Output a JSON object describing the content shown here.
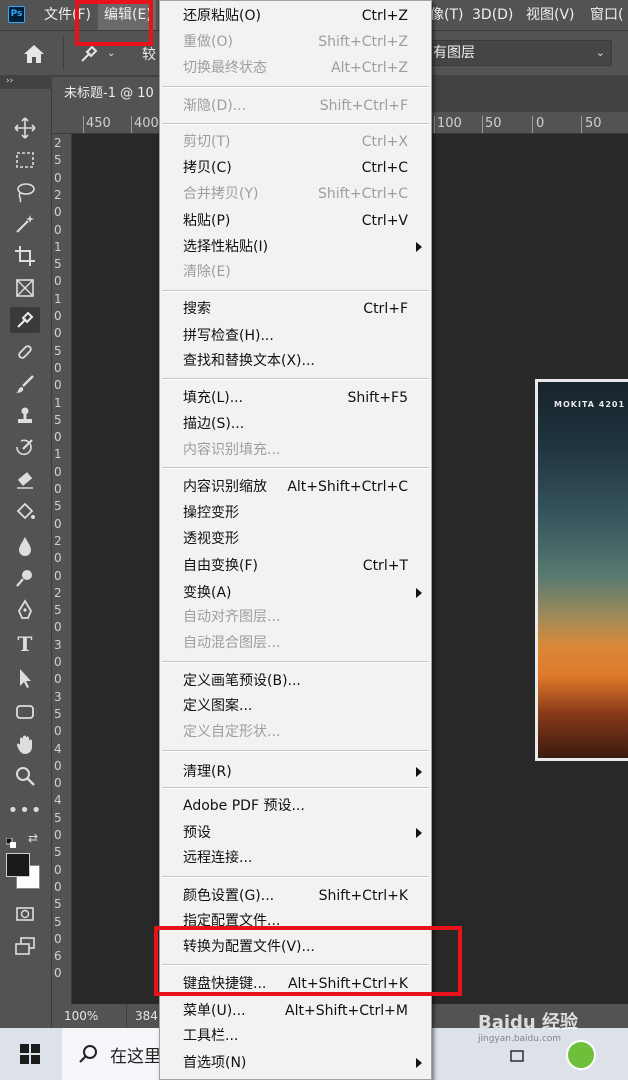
{
  "menubar": {
    "file": "文件(F)",
    "edit": "编辑(E)",
    "image_text": "像(T)",
    "three_d": "3D(D)",
    "view": "视图(V)",
    "window": "窗口("
  },
  "options": {
    "mode_partial": "较",
    "layer_sample": "有图层"
  },
  "document": {
    "tab_title": "未标题-1 @ 10"
  },
  "ruler": {
    "top": [
      "450",
      "400",
      "100",
      "50",
      "0",
      "50"
    ],
    "left": [
      "2",
      "5",
      "0",
      "2",
      "0",
      "0",
      "1",
      "5",
      "0",
      "1",
      "0",
      "0",
      "5",
      "0",
      "0",
      "1",
      "5",
      "0",
      "1",
      "0",
      "0",
      "5",
      "0",
      "2",
      "0",
      "0",
      "2",
      "5",
      "0",
      "3",
      "0",
      "0",
      "3",
      "5",
      "0",
      "4",
      "0",
      "0",
      "4",
      "5",
      "0",
      "5",
      "0",
      "0",
      "5",
      "5",
      "0",
      "6",
      "0"
    ]
  },
  "photo": {
    "caption": "MOKITA   4201"
  },
  "status": {
    "zoom": "100%",
    "info": "384"
  },
  "taskbar": {
    "search_placeholder": "在这里",
    "watermark_text": "Baidu 经验",
    "watermark_url": "jingyan.baidu.com"
  },
  "edit_menu": {
    "undo": {
      "label": "还原粘贴(O)",
      "shortcut": "Ctrl+Z"
    },
    "redo": {
      "label": "重做(O)",
      "shortcut": "Shift+Ctrl+Z"
    },
    "toggle_last": {
      "label": "切换最终状态",
      "shortcut": "Alt+Ctrl+Z"
    },
    "fade": {
      "label": "渐隐(D)...",
      "shortcut": "Shift+Ctrl+F"
    },
    "cut": {
      "label": "剪切(T)",
      "shortcut": "Ctrl+X"
    },
    "copy": {
      "label": "拷贝(C)",
      "shortcut": "Ctrl+C"
    },
    "copy_merged": {
      "label": "合并拷贝(Y)",
      "shortcut": "Shift+Ctrl+C"
    },
    "paste": {
      "label": "粘贴(P)",
      "shortcut": "Ctrl+V"
    },
    "paste_special": {
      "label": "选择性粘贴(I)"
    },
    "clear": {
      "label": "清除(E)"
    },
    "search": {
      "label": "搜索",
      "shortcut": "Ctrl+F"
    },
    "spell_check": {
      "label": "拼写检查(H)..."
    },
    "find_replace": {
      "label": "查找和替换文本(X)..."
    },
    "fill": {
      "label": "填充(L)...",
      "shortcut": "Shift+F5"
    },
    "stroke": {
      "label": "描边(S)..."
    },
    "content_aware_fill": {
      "label": "内容识别填充..."
    },
    "content_aware_scale": {
      "label": "内容识别缩放",
      "shortcut": "Alt+Shift+Ctrl+C"
    },
    "puppet_warp": {
      "label": "操控变形"
    },
    "perspective_warp": {
      "label": "透视变形"
    },
    "free_transform": {
      "label": "自由变换(F)",
      "shortcut": "Ctrl+T"
    },
    "transform": {
      "label": "变换(A)"
    },
    "auto_align": {
      "label": "自动对齐图层..."
    },
    "auto_blend": {
      "label": "自动混合图层..."
    },
    "define_brush": {
      "label": "定义画笔预设(B)..."
    },
    "define_pattern": {
      "label": "定义图案..."
    },
    "define_shape": {
      "label": "定义自定形状..."
    },
    "purge": {
      "label": "清理(R)"
    },
    "pdf_presets": {
      "label": "Adobe PDF 预设..."
    },
    "presets": {
      "label": "预设"
    },
    "remote": {
      "label": "远程连接..."
    },
    "color_settings": {
      "label": "颜色设置(G)...",
      "shortcut": "Shift+Ctrl+K"
    },
    "assign_profile": {
      "label": "指定配置文件..."
    },
    "convert_profile": {
      "label": "转换为配置文件(V)..."
    },
    "keyboard_shortcuts": {
      "label": "键盘快捷键...",
      "shortcut": "Alt+Shift+Ctrl+K"
    },
    "menus": {
      "label": "菜单(U)...",
      "shortcut": "Alt+Shift+Ctrl+M"
    },
    "toolbar": {
      "label": "工具栏..."
    },
    "preferences": {
      "label": "首选项(N)"
    }
  },
  "colors": {
    "highlight_box": "#e8121a",
    "menu_bg": "#f2f2f2",
    "chrome": "#535353"
  }
}
